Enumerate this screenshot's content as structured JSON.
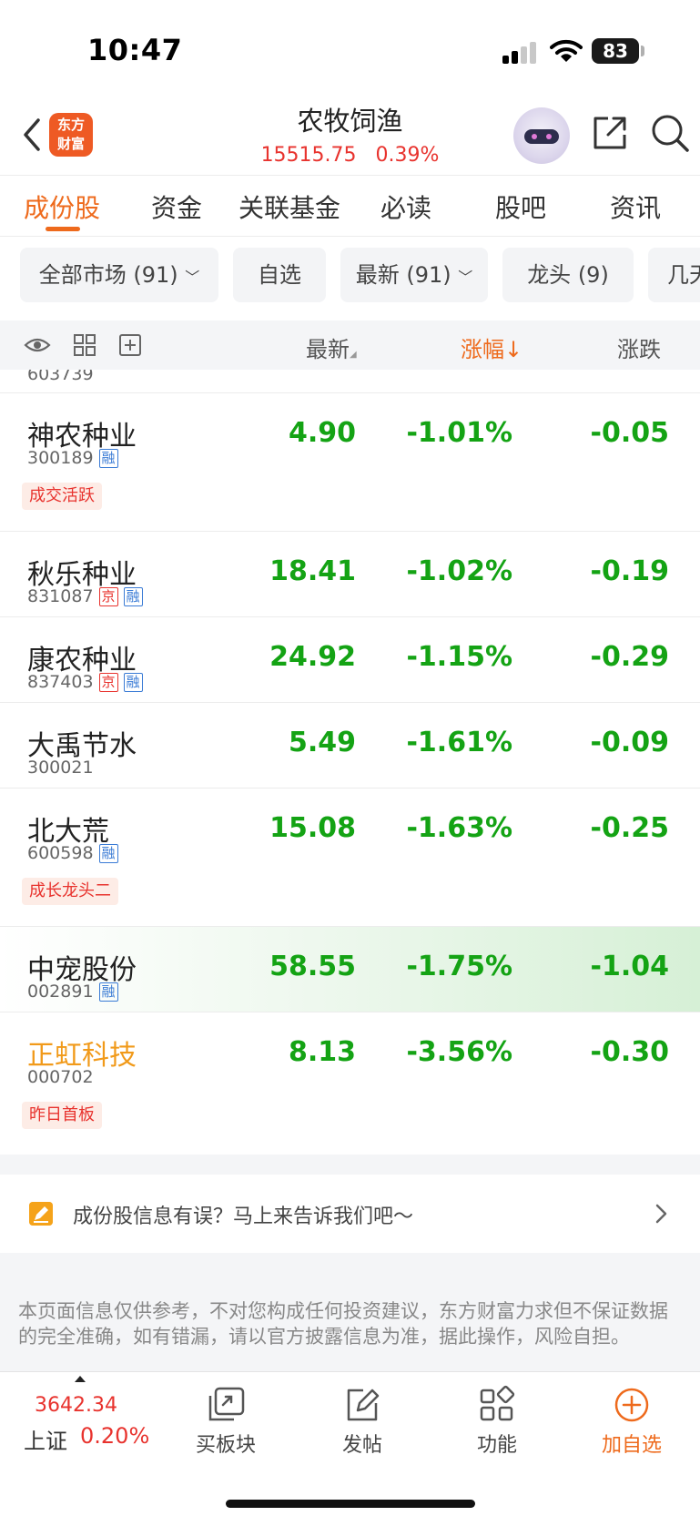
{
  "status_bar": {
    "time": "10:47",
    "battery": "83"
  },
  "header": {
    "logo_line1": "东方",
    "logo_line2": "财富",
    "title": "农牧饲渔",
    "index_value": "15515.75",
    "index_change": "0.39%"
  },
  "tabs": [
    {
      "label": "成份股",
      "active": true
    },
    {
      "label": "资金"
    },
    {
      "label": "关联基金"
    },
    {
      "label": "必读"
    },
    {
      "label": "股吧"
    },
    {
      "label": "资讯"
    }
  ],
  "filters": [
    "全部市场 (91)",
    "自选",
    "最新 (91)",
    "龙头 (9)",
    "几天"
  ],
  "list_header": {
    "latest": "最新",
    "change_pct": "涨幅↓",
    "change": "涨跌"
  },
  "partial_row_code": "603739",
  "rows": [
    {
      "name": "神农种业",
      "code": "300189",
      "badges": [
        "融"
      ],
      "tag": "成交活跃",
      "price": "4.90",
      "pct": "-1.01%",
      "chg": "-0.05"
    },
    {
      "name": "秋乐种业",
      "code": "831087",
      "badges": [
        "京",
        "融"
      ],
      "price": "18.41",
      "pct": "-1.02%",
      "chg": "-0.19"
    },
    {
      "name": "康农种业",
      "code": "837403",
      "badges": [
        "京",
        "融"
      ],
      "price": "24.92",
      "pct": "-1.15%",
      "chg": "-0.29"
    },
    {
      "name": "大禹节水",
      "code": "300021",
      "badges": [],
      "price": "5.49",
      "pct": "-1.61%",
      "chg": "-0.09"
    },
    {
      "name": "北大荒",
      "code": "600598",
      "badges": [
        "融"
      ],
      "tag": "成长龙头二",
      "price": "15.08",
      "pct": "-1.63%",
      "chg": "-0.25"
    },
    {
      "name": "中宠股份",
      "code": "002891",
      "badges": [
        "融"
      ],
      "price": "58.55",
      "pct": "-1.75%",
      "chg": "-1.04"
    },
    {
      "name": "正虹科技",
      "code": "000702",
      "badges": [],
      "tag": "昨日首板",
      "price": "8.13",
      "pct": "-3.56%",
      "chg": "-0.30"
    }
  ],
  "feedback": {
    "text": "成份股信息有误？马上来告诉我们吧～"
  },
  "disclaimer": "本页面信息仅供参考，不对您构成任何投资建议，东方财富力求但不保证数据的完全准确，如有错漏，请以官方披露信息为准，据此操作，风险自担。",
  "bottom_bar": {
    "index_value": "3642.34",
    "index_name": "上证",
    "index_pct": "0.20%",
    "items": [
      {
        "label": "买板块",
        "icon": "buy-sector-icon"
      },
      {
        "label": "发帖",
        "icon": "edit-icon"
      },
      {
        "label": "功能",
        "icon": "grid-icon"
      },
      {
        "label": "加自选",
        "icon": "plus-circle-icon"
      }
    ]
  },
  "colors": {
    "accent": "#ee6a1c",
    "up_red": "#e8332e",
    "down_green": "#14a314"
  }
}
